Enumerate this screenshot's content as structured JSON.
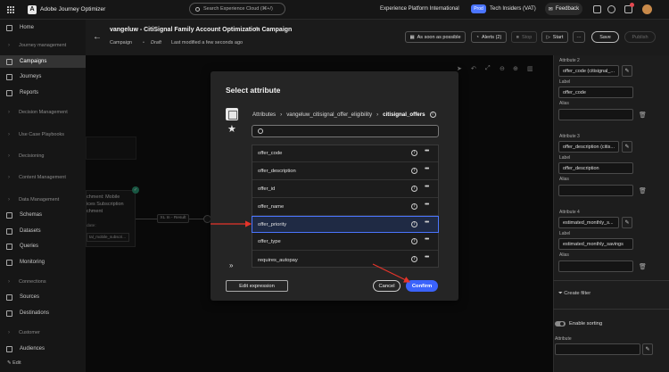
{
  "topbar": {
    "app_name": "Adobe Journey Optimizer",
    "search_placeholder": "Search Experience Cloud (⌘+/)",
    "org": "Experience Platform International",
    "sandbox_badge": "Prod",
    "sandbox_name": "Tech Insiders (VAT)",
    "feedback_label": "Feedback"
  },
  "sidebar": {
    "items": [
      {
        "label": "Home"
      },
      {
        "label": "Campaigns"
      },
      {
        "label": "Journeys"
      },
      {
        "label": "Reports"
      },
      {
        "label": "Schemas"
      },
      {
        "label": "Datasets"
      },
      {
        "label": "Queries"
      },
      {
        "label": "Monitoring"
      },
      {
        "label": "Sources"
      },
      {
        "label": "Destinations"
      },
      {
        "label": "Audiences"
      }
    ],
    "sections": [
      {
        "label": "Journey management"
      },
      {
        "label": "Decision Management"
      },
      {
        "label": "Use Case Playbooks"
      },
      {
        "label": "Decisioning"
      },
      {
        "label": "Content Management"
      },
      {
        "label": "Data Management"
      },
      {
        "label": "Connections"
      },
      {
        "label": "Customer"
      }
    ],
    "edit_label": "Edit"
  },
  "header": {
    "title": "vangeluw - CitiSignal Family Account Optimization Campaign",
    "type": "Campaign",
    "status": "Draft",
    "modified": "Last modified a few seconds ago",
    "schedule_label": "As soon as possible",
    "alerts_label": "Alerts (2)",
    "stop_label": "Stop",
    "start_label": "Start",
    "save_label": "Save",
    "publish_label": "Publish"
  },
  "canvas": {
    "node_title_1": "chment: Mobile",
    "node_title_2": "ices Subscription",
    "node_title_3": "chment",
    "node_field_label": "date:",
    "node_field_value": "tal_mobile_subscri...",
    "connector_label": "XL In - Result"
  },
  "right_panel": {
    "attributes": [
      {
        "heading": "Attribute 2",
        "value": "offer_code (citisignal_...",
        "label_caption": "Label",
        "label_value": "offer_code",
        "alias_caption": "Alias",
        "alias_value": ""
      },
      {
        "heading": "Attribute 3",
        "value": "offer_description (citis...",
        "label_caption": "Label",
        "label_value": "offer_description",
        "alias_caption": "Alias",
        "alias_value": ""
      },
      {
        "heading": "Attribute 4",
        "value": "estimated_monthly_s...",
        "label_caption": "Label",
        "label_value": "estimated_monthly_savings",
        "alias_caption": "Alias",
        "alias_value": ""
      }
    ],
    "create_filter": "Create filter",
    "enable_sorting": "Enable sorting",
    "attribute_caption": "Attribute"
  },
  "modal": {
    "title": "Select attribute",
    "breadcrumb": [
      "Attributes",
      "vangeluw_citisignal_offer_eligibility",
      "citisignal_offers"
    ],
    "search_placeholder": "",
    "attributes": [
      {
        "name": "offer_code"
      },
      {
        "name": "offer_description"
      },
      {
        "name": "offer_id"
      },
      {
        "name": "offer_name"
      },
      {
        "name": "offer_priority"
      },
      {
        "name": "offer_type"
      },
      {
        "name": "requires_autopay"
      }
    ],
    "selected_index": 4,
    "edit_expression_label": "Edit expression",
    "cancel_label": "Cancel",
    "confirm_label": "Confirm"
  },
  "colors": {
    "accent": "#3b63fb",
    "selection": "#4b75ff",
    "annotation_arrow": "#e5342a",
    "enabled_green": "#2d9d78"
  },
  "icons": [
    "grid-icon",
    "search-icon",
    "help-icon",
    "bell-icon",
    "apps-icon",
    "back-arrow-icon",
    "pencil-icon",
    "star-icon",
    "info-icon",
    "more-icon",
    "trash-icon",
    "filter-icon",
    "expand-icon"
  ]
}
